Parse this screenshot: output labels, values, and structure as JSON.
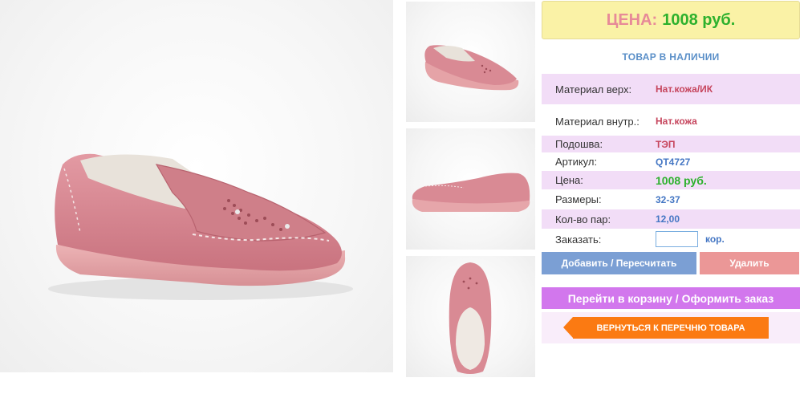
{
  "product": {
    "price_label": "ЦЕНА:",
    "price_value": "1008 руб.",
    "stock_status": "ТОВАР В НАЛИЧИИ"
  },
  "specs": [
    {
      "label": "Материал верх:",
      "value": "Нат.кожа/ИК"
    },
    {
      "label": "Материал внутр.:",
      "value": "Нат.кожа"
    },
    {
      "label": "Подошва:",
      "value": "ТЭП"
    },
    {
      "label": "Артикул:",
      "value": "QT4727"
    },
    {
      "label": "Цена:",
      "value": "1008 руб."
    },
    {
      "label": "Размеры:",
      "value": "32-37"
    },
    {
      "label": "Кол-во пар:",
      "value": "12,00"
    }
  ],
  "order": {
    "label": "Заказать:",
    "input_value": "",
    "unit": "кор."
  },
  "buttons": {
    "add": "Добавить / Пересчитать",
    "delete": "Удалить",
    "cart": "Перейти в корзину / Оформить заказ",
    "back": "ВЕРНУТЬСЯ К ПЕРЕЧНЮ ТОВАРА"
  },
  "colors": {
    "price_box": "#faf2a6",
    "price_label": "#e78a98",
    "price_value": "#2db12d",
    "stock": "#5a8fc8",
    "row_highlight": "#f2ddf7",
    "add_button": "#7b9fd4",
    "delete_button": "#eb9797",
    "cart_button": "#d277ed",
    "back_button": "#fb7a12",
    "shoe": "#d98a94"
  }
}
